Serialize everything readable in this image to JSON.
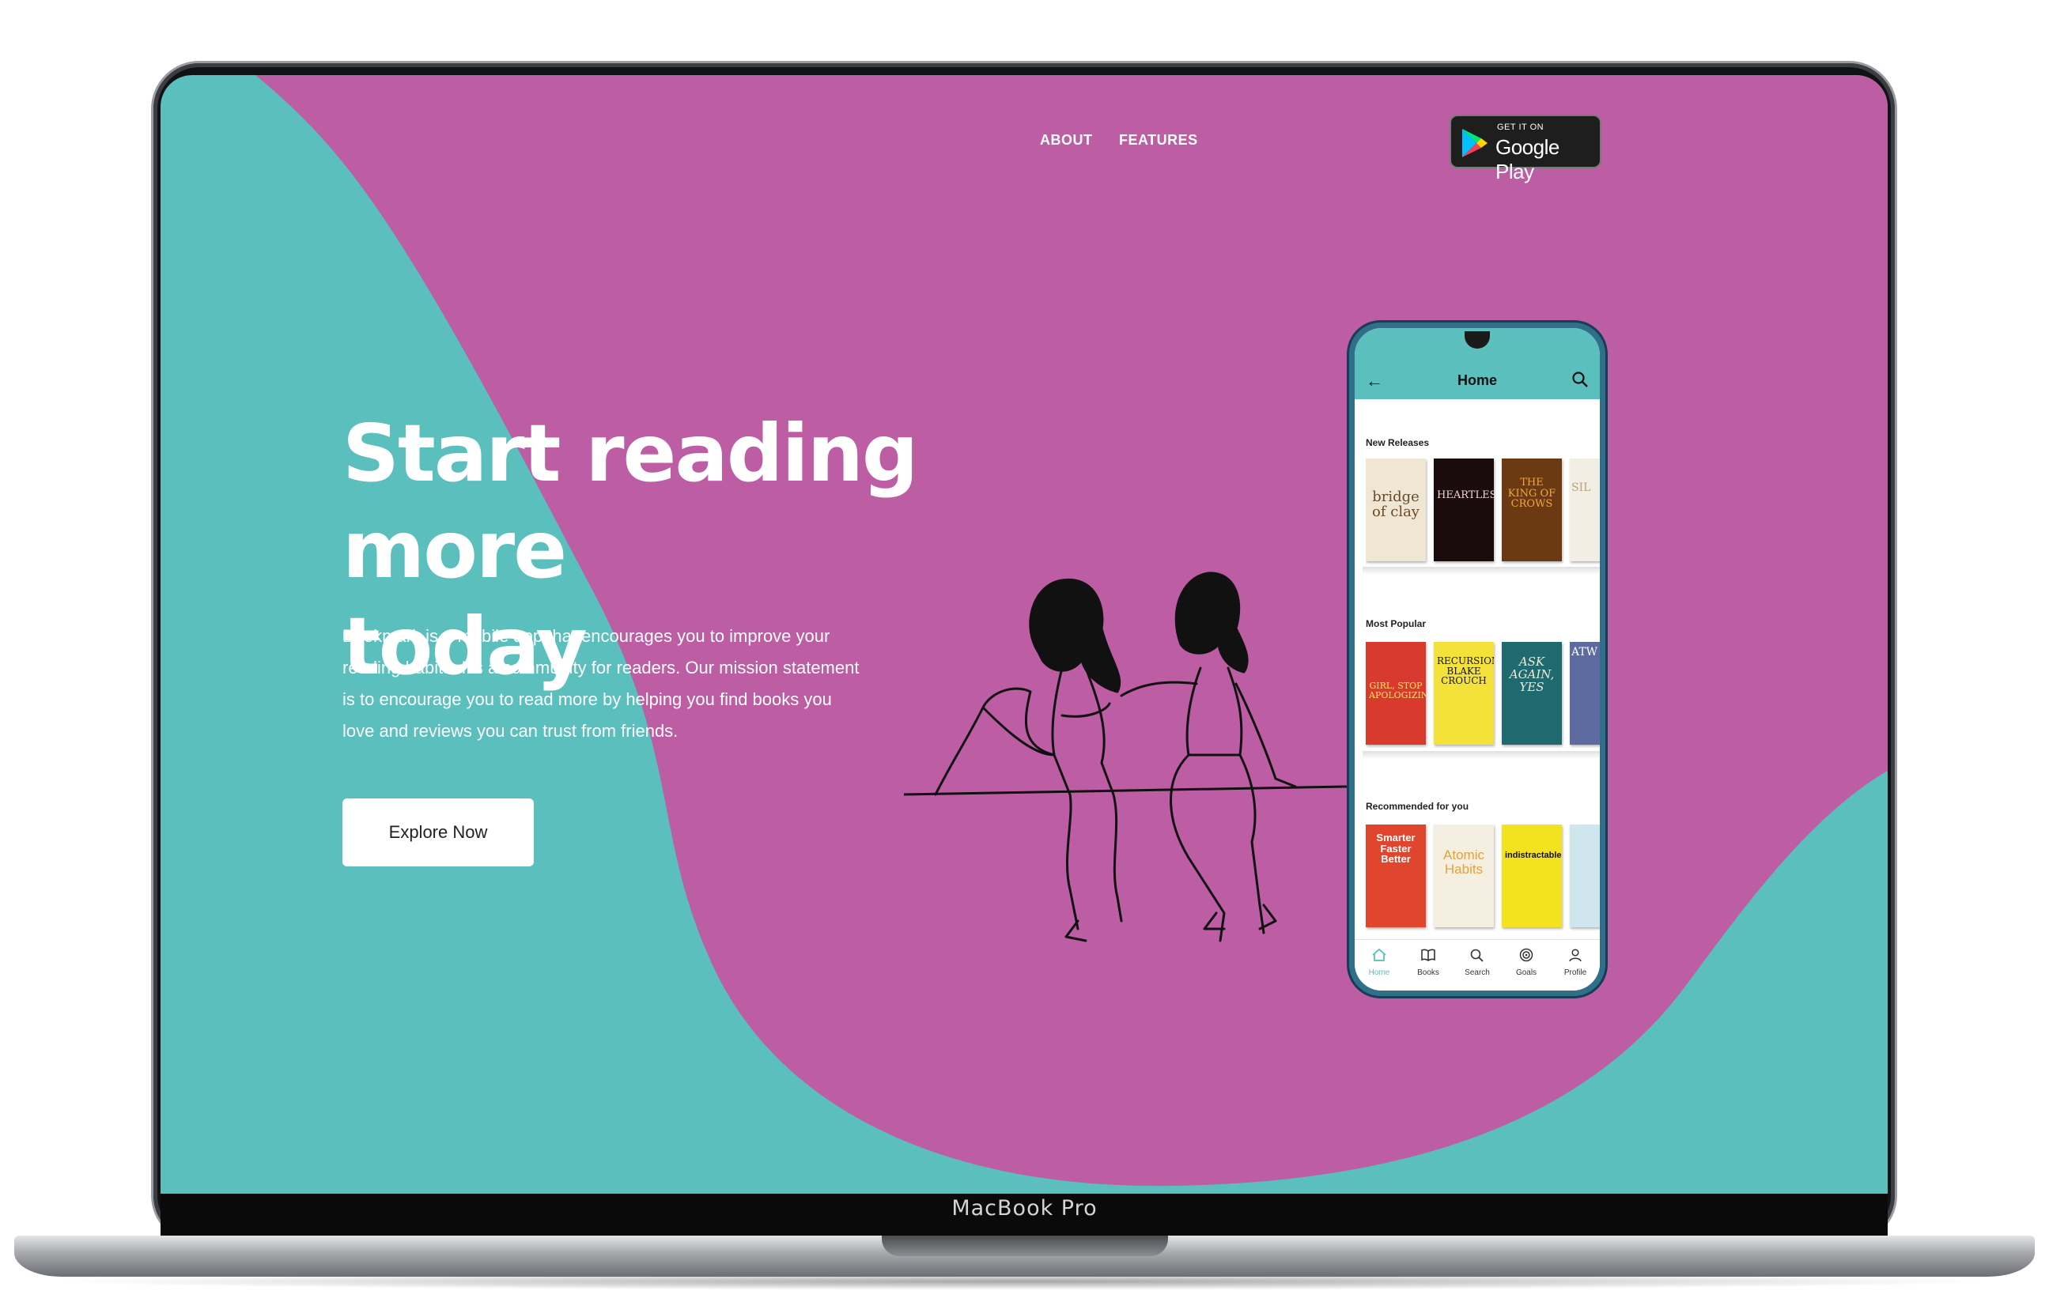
{
  "nav": {
    "about": "ABOUT",
    "features": "FEATURES",
    "google_play": {
      "small": "GET IT ON",
      "large": "Google Play"
    }
  },
  "hero": {
    "headline_line1": "Start reading more",
    "headline_line2": "today",
    "description": "Bookmark is a mobile app that encourages you to improve your reading habits. It's a community for readers. Our mission statement is to encourage you to read more by helping you find books you love and reviews you can trust from friends.",
    "cta_label": "Explore Now"
  },
  "laptop": {
    "brand": "MacBook Pro"
  },
  "phone": {
    "title": "Home",
    "sections": [
      {
        "label": "New Releases",
        "books": [
          "bridge of clay",
          "HEARTLESS",
          "THE KING OF CROWS",
          "SIL"
        ]
      },
      {
        "label": "Most Popular",
        "books": [
          "GIRL, STOP APOLOGIZING",
          "RECURSION BLAKE CROUCH",
          "ASK AGAIN, YES",
          "ATW"
        ]
      },
      {
        "label": "Recommended for you",
        "books": [
          "Smarter Faster Better",
          "Atomic Habits",
          "indistractable",
          ""
        ]
      }
    ],
    "tabs": [
      "Home",
      "Books",
      "Search",
      "Goals",
      "Profile"
    ],
    "active_tab": "Home"
  },
  "colors": {
    "teal": "#5bbfbd",
    "magenta": "#bd5da3",
    "white": "#ffffff"
  },
  "icons": [
    "google-play-icon",
    "back-arrow-icon",
    "search-icon",
    "home-icon",
    "book-icon",
    "target-icon",
    "user-icon"
  ]
}
